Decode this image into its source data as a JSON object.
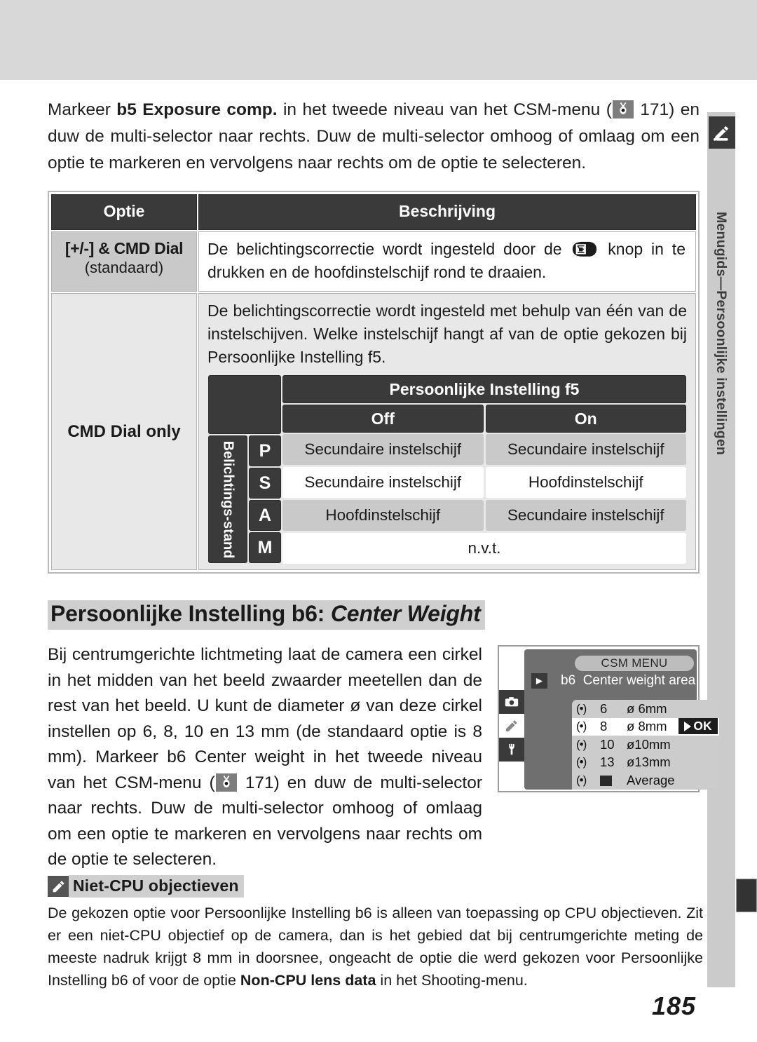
{
  "sidebar": {
    "label": "Menugids—Persoonlijke instellingen",
    "icon": "pencil-icon"
  },
  "intro": {
    "part1": "Markeer ",
    "bold1": "b5 Exposure comp.",
    "part2": " in het tweede niveau van het CSM-menu (",
    "ref_icon": "magnifier-reference-icon",
    "page_ref": " 171) en duw de multi-selector naar rechts. Duw de multi-selector omhoog of omlaag om een optie te markeren en vervolgens naar rechts om de optie te selecteren."
  },
  "table": {
    "headers": {
      "option": "Optie",
      "description": "Beschrijving"
    },
    "row1": {
      "option_line1": "[+/-] & CMD Dial",
      "option_line2": "(standaard)",
      "desc_part1": "De belichtingscorrectie wordt ingesteld door de ",
      "desc_icon": "exposure-compensation-button-icon",
      "desc_part2": " knop in te drukken en de hoofdinstelschijf rond te draaien."
    },
    "row2": {
      "option": "CMD Dial only",
      "desc": "De belichtingscorrectie wordt ingesteld met behulp van één van de instelschijven. Welke instelschijf hangt af van de optie gekozen bij Persoonlijke Instelling f5.",
      "subtable": {
        "title": "Persoonlijke Instelling f5",
        "col_off": "Off",
        "col_on": "On",
        "vertical_label": "Belichtings-stand",
        "rows": [
          {
            "mode": "P",
            "off": "Secundaire instelschijf",
            "on": "Secundaire instelschijf"
          },
          {
            "mode": "S",
            "off": "Secundaire instelschijf",
            "on": "Hoofdinstelschijf"
          },
          {
            "mode": "A",
            "off": "Hoofdinstelschijf",
            "on": "Secundaire instelschijf"
          },
          {
            "mode": "M",
            "span": "n.v.t."
          }
        ]
      }
    }
  },
  "section": {
    "heading_normal": "Persoonlijke Instelling b6: ",
    "heading_italic": "Center Weight",
    "body_part1": "Bij centrumgerichte lichtmeting laat de camera een cirkel in het midden van het beeld zwaarder meetellen dan de rest van het beeld. U kunt de diameter ø van deze cirkel instellen op 6, 8, 10 en 13 mm (de standaard optie is 8 mm). Markeer ",
    "body_bold": "b6 Center weight",
    "body_part2": " in het tweede niveau van het CSM-menu (",
    "ref_icon": "magnifier-reference-icon",
    "body_part3": " 171) en duw de multi-selector naar rechts. Duw de multi-selector omhoog of omlaag om een optie te markeren en vervolgens naar rechts om de optie te selecteren."
  },
  "lcd": {
    "title": "CSM MENU",
    "subtitle_code": "b6",
    "subtitle": "Center weight area",
    "play_icon": "playback-icon",
    "rail_icons": [
      "camera-icon",
      "pencil-icon",
      "wrench-icon"
    ],
    "items": [
      {
        "radio": "(•)",
        "num": "6",
        "diameter": "ø  6mm",
        "selected": false
      },
      {
        "radio": "(•)",
        "num": "8",
        "diameter": "ø  8mm",
        "selected": true
      },
      {
        "radio": "(•)",
        "num": "10",
        "diameter": "ø10mm",
        "selected": false
      },
      {
        "radio": "(•)",
        "num": "13",
        "diameter": "ø13mm",
        "selected": false
      },
      {
        "radio": "(•)",
        "num": "",
        "diameter": "Average",
        "selected": false,
        "square": true
      }
    ],
    "ok_label": "OK"
  },
  "note": {
    "icon": "pencil-note-icon",
    "title": "Niet-CPU objectieven",
    "body_part1": "De gekozen optie voor Persoonlijke Instelling b6 is alleen van toepassing op CPU objectieven. Zit er een niet-CPU objectief op de camera, dan is het gebied dat bij centrumgerichte meting de meeste nadruk krijgt 8 mm in doorsnee, ongeacht de optie die werd gekozen voor Persoonlijke Instelling b6 of voor de optie ",
    "body_bold": "Non-CPU lens data",
    "body_part2": " in het Shooting-menu."
  },
  "page_number": "185",
  "colors": {
    "band": "#d8d8d8",
    "header_dark": "#3a3a3a",
    "cell_shade": "#c9c9c9",
    "cell_light": "#e8e8e8",
    "highlight": "#cfcfcf",
    "lcd_bg": "#6f6f6f"
  }
}
